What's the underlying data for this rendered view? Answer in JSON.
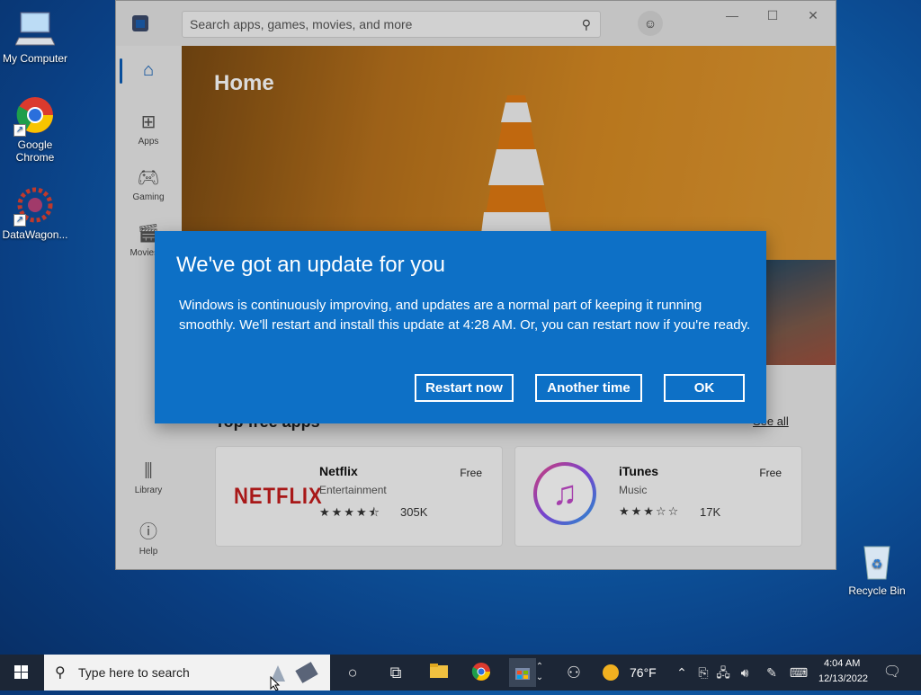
{
  "desktop": {
    "icons": [
      {
        "label": "My Computer"
      },
      {
        "label": "Google Chrome"
      },
      {
        "label": "DataWagon..."
      },
      {
        "label": "Recycle Bin"
      }
    ]
  },
  "store": {
    "search_placeholder": "Search apps, games, movies, and more",
    "nav": [
      {
        "label": "Home",
        "icon": "home-icon"
      },
      {
        "label": "Apps",
        "icon": "apps-icon"
      },
      {
        "label": "Gaming",
        "icon": "gaming-icon"
      },
      {
        "label": "Movies & TV",
        "icon": "movies-icon",
        "shown": "Movies &"
      },
      {
        "label": "Library",
        "icon": "library-icon"
      },
      {
        "label": "Help",
        "icon": "help-icon"
      }
    ],
    "hero_title": "Home",
    "section_title": "Top free apps",
    "see_all": "See all",
    "cards": [
      {
        "name": "Netflix",
        "category": "Entertainment",
        "price": "Free",
        "rating": 4.5,
        "stars": "★★★★⯪",
        "count": "305K"
      },
      {
        "name": "iTunes",
        "category": "Music",
        "price": "Free",
        "rating": 3,
        "stars": "★★★☆☆",
        "count": "17K"
      }
    ]
  },
  "dialog": {
    "title": "We've got an update for you",
    "body": "Windows is continuously improving, and updates are a normal part of keeping it running smoothly. We'll restart and install this update at 4:28 AM. Or, you can restart now if you're ready.",
    "buttons": {
      "restart_now": "Restart now",
      "another_time": "Another time",
      "ok": "OK"
    }
  },
  "taskbar": {
    "search_placeholder": "Type here to search",
    "weather": "76°F",
    "time": "4:04 AM",
    "date": "12/13/2022"
  },
  "colors": {
    "dialog_bg": "#0d70c6",
    "accent": "#0a5bb5",
    "taskbar": "#1c2636"
  }
}
